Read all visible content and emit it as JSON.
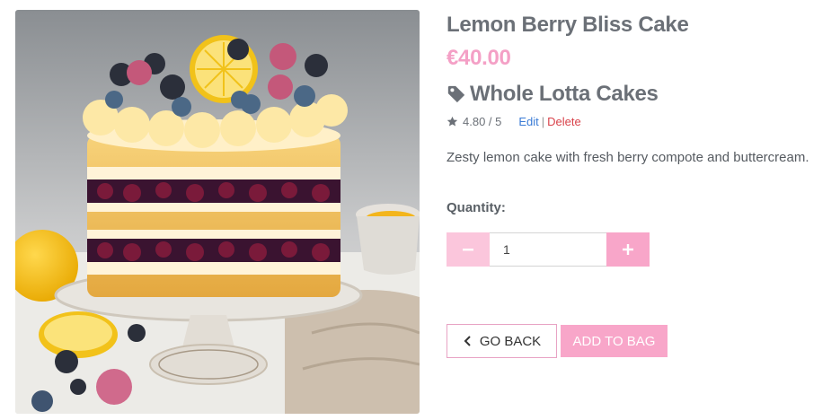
{
  "product": {
    "title": "Lemon Berry Bliss Cake",
    "price": "€40.00",
    "vendor": "Whole Lotta Cakes",
    "rating": "4.80 / 5",
    "edit_label": "Edit",
    "separator": "|",
    "delete_label": "Delete",
    "description": "Zesty lemon cake with fresh berry compote and buttercream."
  },
  "quantity": {
    "label": "Quantity:",
    "value": "1"
  },
  "actions": {
    "back_label": "GO BACK",
    "add_label": "ADD TO BAG"
  },
  "icons": {
    "vendor": "tag-icon",
    "rating": "star-icon",
    "decrement": "minus-icon",
    "increment": "plus-icon",
    "back": "chevron-left-icon"
  },
  "colors": {
    "accent_pink": "#f8a6c9",
    "price_pink": "#f4a0c6",
    "link_blue": "#3a7bd5",
    "delete_red": "#d9434b"
  }
}
